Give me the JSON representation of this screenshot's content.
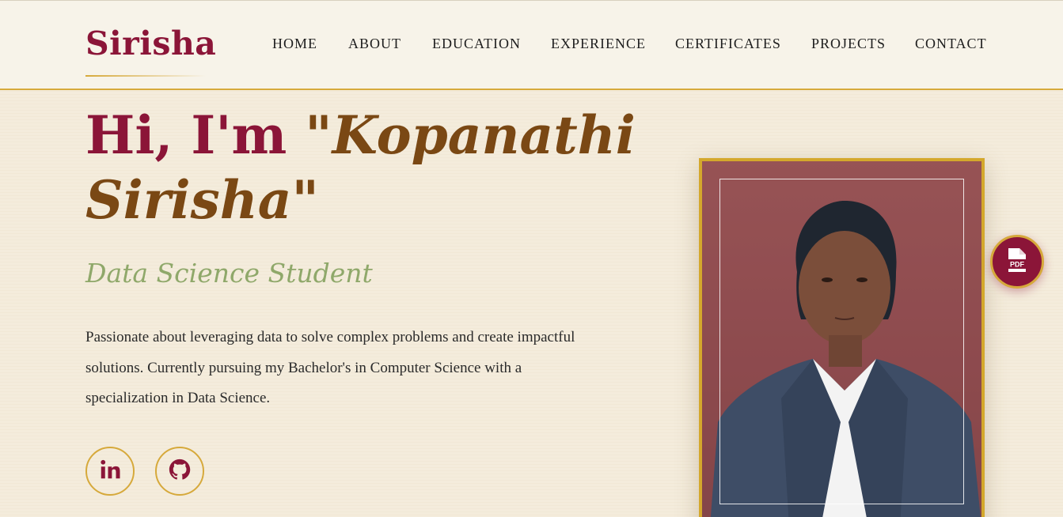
{
  "header": {
    "logo": "Sirisha",
    "nav": [
      "HOME",
      "ABOUT",
      "EDUCATION",
      "EXPERIENCE",
      "CERTIFICATES",
      "PROJECTS",
      "CONTACT"
    ]
  },
  "hero": {
    "greeting": "Hi, I'm ",
    "name": "\"Kopanathi Sirisha\"",
    "subtitle": "Data Science Student",
    "bio": "Passionate about leveraging data to solve complex problems and create impactful solutions. Currently pursuing my Bachelor's in Computer Science with a specialization in Data Science."
  },
  "social": [
    {
      "icon": "linkedin-icon"
    },
    {
      "icon": "github-icon"
    }
  ],
  "floating": {
    "icon": "pdf-file-icon",
    "label": "PDF"
  },
  "colors": {
    "primary": "#8b1538",
    "accent_gold": "#d6a93b",
    "name_brown": "#7a4814",
    "subtitle_green": "#8fa86a",
    "background": "#f4ecdc"
  }
}
